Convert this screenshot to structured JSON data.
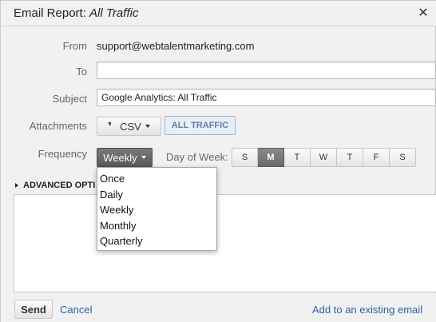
{
  "dialog": {
    "title_prefix": "Email Report: ",
    "title_report": "All Traffic",
    "close_glyph": "✕"
  },
  "form": {
    "from_label": "From",
    "from_value": "support@webtalentmarketing.com",
    "to_label": "To",
    "to_value": "",
    "subject_label": "Subject",
    "subject_value": "Google Analytics: All Traffic",
    "attachments_label": "Attachments",
    "attachment_format": "CSV",
    "attachment_mark": "❜",
    "attachment_report": "ALL TRAFFIC",
    "frequency_label": "Frequency",
    "frequency_value": "Weekly",
    "day_of_week_label": "Day of Week:",
    "days": [
      "S",
      "M",
      "T",
      "W",
      "T",
      "F",
      "S"
    ],
    "selected_day_index": 1
  },
  "frequency_menu": {
    "options": [
      "Once",
      "Daily",
      "Weekly",
      "Monthly",
      "Quarterly"
    ]
  },
  "advanced": {
    "label": "ADVANCED OPTI"
  },
  "footer": {
    "send_label": "Send",
    "cancel_label": "Cancel",
    "add_existing_label": "Add to an existing email"
  },
  "colors": {
    "link": "#2a63a8",
    "active_day": "#6b6b6b",
    "pill_text": "#5b7fa7"
  }
}
